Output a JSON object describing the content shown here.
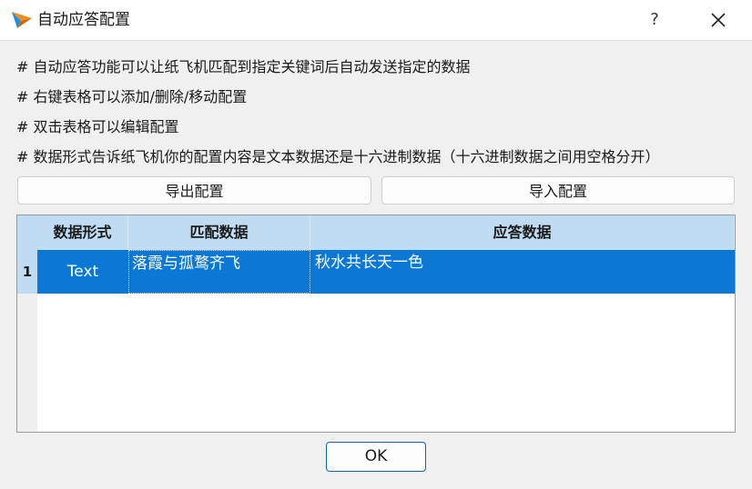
{
  "window": {
    "title": "自动应答配置",
    "help_label": "?",
    "icons": {
      "app": "paper-plane-icon",
      "close": "close-icon"
    },
    "colors": {
      "accent": "#0a78d4",
      "header_bg": "#bfdcf2",
      "window_bg": "#f0f0f0"
    }
  },
  "help_lines": [
    "# 自动应答功能可以让纸飞机匹配到指定关键词后自动发送指定的数据",
    "# 右键表格可以添加/删除/移动配置",
    "# 双击表格可以编辑配置",
    "# 数据形式告诉纸飞机你的配置内容是文本数据还是十六进制数据（十六进制数据之间用空格分开）"
  ],
  "buttons": {
    "export": "导出配置",
    "import": "导入配置",
    "ok": "OK"
  },
  "table": {
    "columns": [
      "数据形式",
      "匹配数据",
      "应答数据"
    ],
    "rows": [
      {
        "index": "1",
        "format": "Text",
        "match": "落霞与孤鹜齐飞",
        "reply": "秋水共长天一色",
        "selected": true
      }
    ]
  }
}
